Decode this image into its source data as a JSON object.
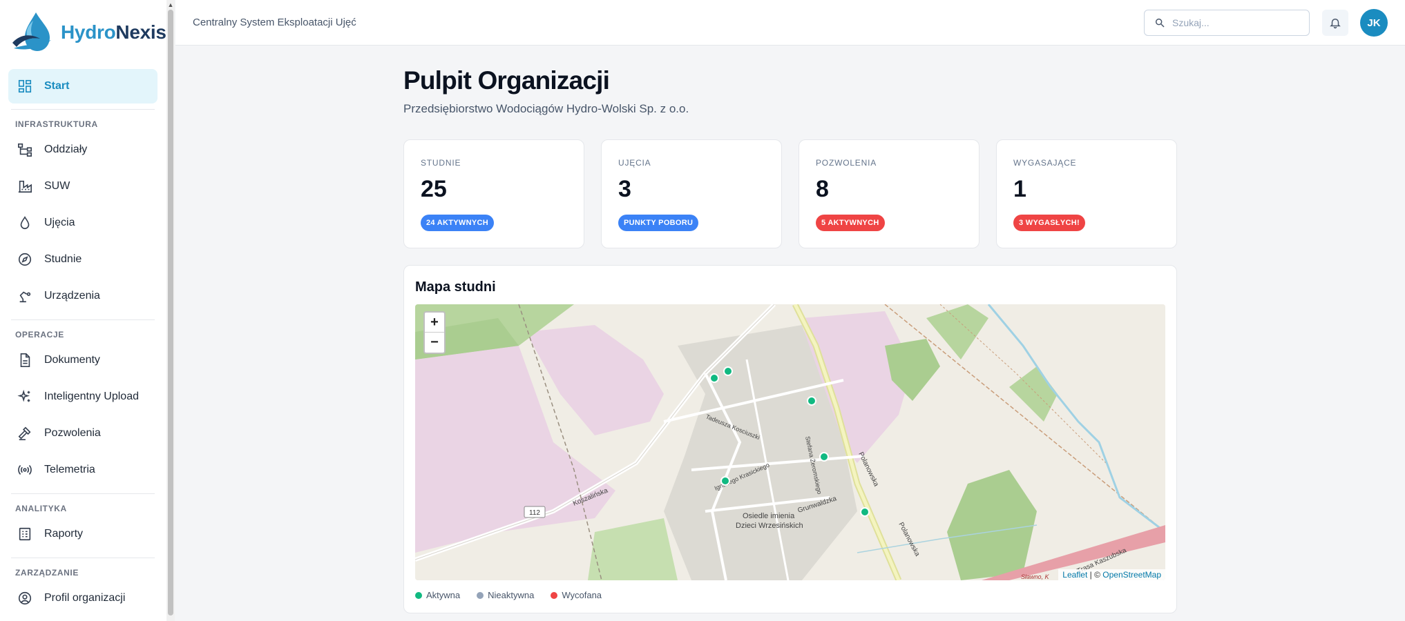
{
  "brand": {
    "name_part1": "Hydro",
    "name_part2": "Nexis"
  },
  "sidebar": {
    "start": "Start",
    "sections": {
      "infrastruktura": "INFRASTRUKTURA",
      "operacje": "OPERACJE",
      "analityka": "ANALITYKA",
      "zarzadzanie": "ZARZĄDZANIE"
    },
    "items": {
      "oddzialy": "Oddziały",
      "suw": "SUW",
      "ujecia": "Ujęcia",
      "studnie": "Studnie",
      "urzadzenia": "Urządzenia",
      "dokumenty": "Dokumenty",
      "upload": "Inteligentny Upload",
      "pozwolenia": "Pozwolenia",
      "telemetria": "Telemetria",
      "raporty": "Raporty",
      "profil": "Profil organizacji"
    }
  },
  "topbar": {
    "title": "Centralny System Eksploatacji Ujęć",
    "search_placeholder": "Szukaj...",
    "avatar_initials": "JK"
  },
  "page": {
    "title": "Pulpit Organizacji",
    "subtitle": "Przedsiębiorstwo Wodociągów Hydro-Wolski Sp. z o.o."
  },
  "stats": [
    {
      "label": "STUDNIE",
      "value": "25",
      "badge": "24 AKTYWNYCH",
      "badge_color": "#3b82f6"
    },
    {
      "label": "UJĘCIA",
      "value": "3",
      "badge": "PUNKTY POBORU",
      "badge_color": "#3b82f6"
    },
    {
      "label": "POZWOLENIA",
      "value": "8",
      "badge": "5 AKTYWNYCH",
      "badge_color": "#ef4444"
    },
    {
      "label": "WYGASAJĄCE",
      "value": "1",
      "badge": "3 WYGASŁYCH!",
      "badge_color": "#ef4444"
    }
  ],
  "map": {
    "title": "Mapa studni",
    "zoom_in": "+",
    "zoom_out": "−",
    "attribution_leaflet": "Leaflet",
    "attribution_sep": " | © ",
    "attribution_osm": "OpenStreetMap",
    "labels": {
      "road_number": "112",
      "koszalinska": "Koszalińska",
      "polanowska": "Polanowska",
      "polanowska2": "Polanowska",
      "osiedle": "Osiedle imienia",
      "dzieci": "Dzieci Wrzesińskich",
      "grunwaldzka": "Grunwaldzka",
      "kosciuszki": "Tadeusza Kosciuszki",
      "zeromskiego": "Stefana Żeromskiego",
      "krasickiego": "Ignacego Krasickiego",
      "traktat": "Trasa Kaszubska",
      "slawno": "Sławno, K"
    }
  },
  "legend": [
    {
      "label": "Aktywna",
      "color": "#10b981"
    },
    {
      "label": "Nieaktywna",
      "color": "#94a3b8"
    },
    {
      "label": "Wycofana",
      "color": "#ef4444"
    }
  ]
}
